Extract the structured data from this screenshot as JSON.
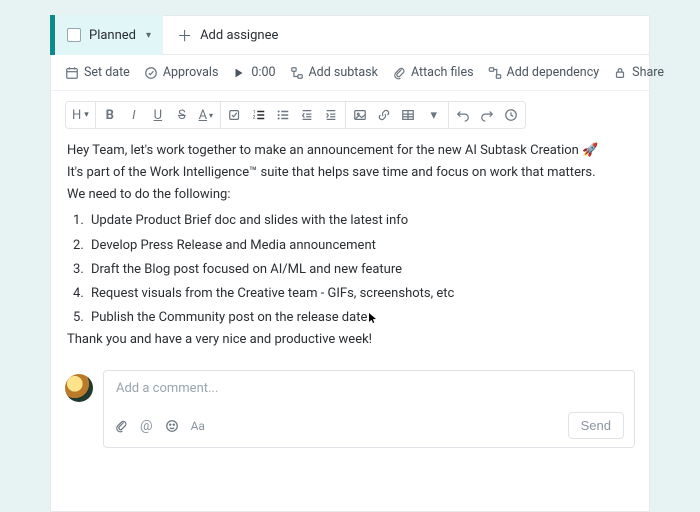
{
  "header": {
    "status_label": "Planned",
    "add_assignee": "Add assignee"
  },
  "meta": {
    "set_date": "Set date",
    "approvals": "Approvals",
    "timer": "0:00",
    "add_subtask": "Add subtask",
    "attach_files": "Attach files",
    "add_dependency": "Add dependency",
    "share": "Share"
  },
  "toolbar": {
    "heading": "H"
  },
  "body": {
    "line1": "Hey Team, let's work together to make an announcement for the new AI Subtask Creation 🚀",
    "line2": "It's part of the Work Intelligence™ suite that helps save time and focus on work that matters.",
    "list_intro": "We need to do the following:",
    "items": [
      "Update Product Brief doc and slides with the latest info",
      "Develop Press Release and Media announcement",
      "Draft the Blog post focused on AI/ML and new feature",
      "Request visuals from the Creative team - GIFs, screenshots, etc",
      "Publish the Community post on the release date"
    ],
    "closing": "Thank you and have a very nice and productive week!"
  },
  "comment": {
    "placeholder": "Add a comment...",
    "send": "Send"
  }
}
